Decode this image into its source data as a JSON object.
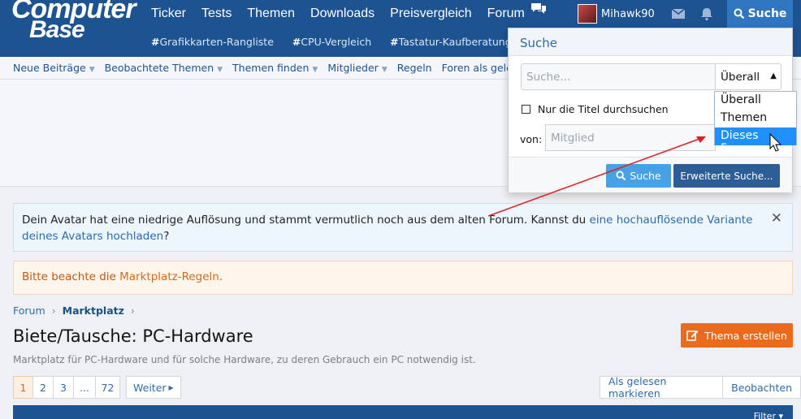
{
  "header": {
    "logo_line1": "Computer",
    "logo_line2": "Base",
    "nav": [
      "Ticker",
      "Tests",
      "Themen",
      "Downloads",
      "Preisvergleich",
      "Forum"
    ],
    "username": "Mihawk90",
    "search_label": "Suche",
    "tags": [
      "Grafikkarten-Rangliste",
      "CPU-Vergleich",
      "Tastatur-Kaufberatung"
    ]
  },
  "subnav": [
    "Neue Beiträge",
    "Beobachtete Themen",
    "Themen finden",
    "Mitglieder",
    "Regeln",
    "Foren als gelese"
  ],
  "search_menu": {
    "title": "Suche",
    "query_placeholder": "Suche...",
    "scope_value": "Überall",
    "titles_only_label": "Nur die Titel durchsuchen",
    "from_label": "von:",
    "member_placeholder": "Mitglied",
    "search_button": "Suche",
    "advanced_button": "Erweiterte Suche...",
    "scope_options": [
      "Überall",
      "Themen",
      "Dieses Forum"
    ],
    "highlighted_option": "Dieses Forum"
  },
  "notices": {
    "avatar_text": "Dein Avatar hat eine niedrige Auflösung und stammt vermutlich noch aus dem alten Forum. Kannst du ",
    "avatar_link": "eine hochauflösende Variante deines Avatars hochladen",
    "avatar_tail": "?",
    "rules_text": "Bitte beachte die ",
    "rules_link": "Marktplatz-Regeln",
    "rules_tail": "."
  },
  "breadcrumb": {
    "root": "Forum",
    "current": "Marktplatz"
  },
  "page": {
    "title": "Biete/Tausche: PC-Hardware",
    "description": "Marktplatz für PC-Hardware und für solche Hardware, zu deren Gebrauch ein PC notwendig ist.",
    "new_thread": "Thema erstellen"
  },
  "pagination": {
    "pages": [
      "1",
      "2",
      "3",
      "...",
      "72"
    ],
    "current": "1",
    "next": "Weiter"
  },
  "actions": [
    "Als gelesen markieren",
    "Beobachten"
  ],
  "filter_label": "Filter"
}
